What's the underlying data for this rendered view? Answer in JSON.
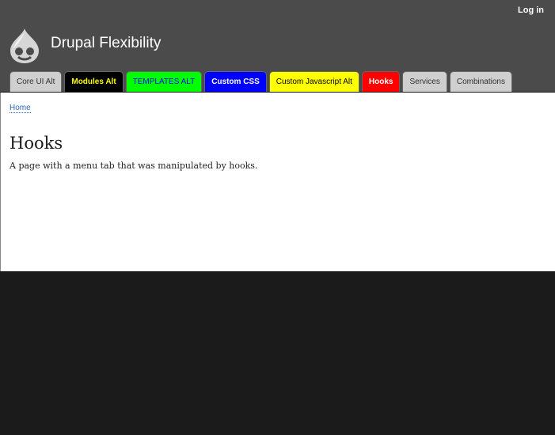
{
  "header": {
    "login_label": "Log in",
    "site_name": "Drupal Flexibility",
    "logo_icon": "drupal-drop-icon"
  },
  "tabs": [
    {
      "label": "Core UI Alt",
      "bg": "#cfcfcf",
      "color": "#333333",
      "bold": false
    },
    {
      "label": "Modules Alt",
      "bg": "#000000",
      "color": "#ffff00",
      "bold": true
    },
    {
      "label": "TEMPLATES ALT",
      "bg": "#00ff00",
      "color": "#0000ff",
      "bold": false
    },
    {
      "label": "Custom CSS",
      "bg": "#0000ff",
      "color": "#ffffff",
      "bold": true
    },
    {
      "label": "Custom Javascript Alt",
      "bg": "#ffff00",
      "color": "#000000",
      "bold": false
    },
    {
      "label": "Hooks",
      "bg": "#ff0000",
      "color": "#ffffff",
      "bold": true
    },
    {
      "label": "Services",
      "bg": "#cfcfcf",
      "color": "#333333",
      "bold": false
    },
    {
      "label": "Combinations",
      "bg": "#cfcfcf",
      "color": "#333333",
      "bold": false
    }
  ],
  "content": {
    "breadcrumb": "Home",
    "title": "Hooks",
    "body": "A page with a menu tab that was manipulated by hooks."
  }
}
